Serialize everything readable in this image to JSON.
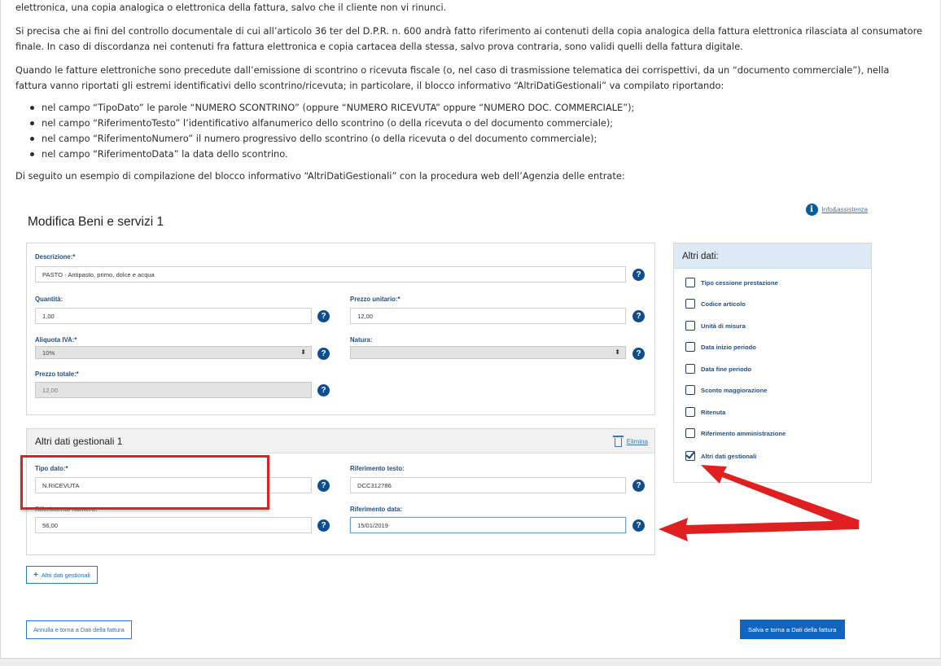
{
  "article": {
    "p0": "elettronica, una  copia analogica o elettronica della fattura, salvo che il cliente non vi rinunci.",
    "p1": "Si precisa che ai fini del controllo documentale di cui all’articolo 36 ter del D.P.R. n. 600 andrà fatto riferimento ai contenuti della copia analogica della fattura elettronica rilasciata al consumatore finale. In caso di discordanza nei contenuti fra fattura elettronica e copia cartacea della stessa, salvo prova contraria, sono validi quelli della fattura digitale.",
    "p2": "Quando le fatture elettroniche sono precedute dall’emissione di scontrino o ricevuta fiscale (o, nel caso di trasmissione telematica dei corrispettivi, da un “documento commerciale”), nella fattura vanno riportati gli estremi identificativi dello scontrino/ricevuta; in particolare, il blocco informativo “AltriDatiGestionali” va compilato riportando:",
    "bullets": [
      "nel campo “TipoDato” le parole “NUMERO SCONTRINO” (oppure “NUMERO RICEVUTA” oppure “NUMERO DOC. COMMERCIALE”);",
      "nel campo “RiferimentoTesto” l’identificativo alfanumerico dello scontrino (o della ricevuta o del documento commerciale);",
      "nel campo “RiferimentoNumero” il numero progressivo dello scontrino (o della ricevuta o del documento commerciale);",
      "nel campo “RiferimentoData” la data dello scontrino."
    ],
    "p3": "Di seguito un esempio di compilazione del blocco informativo “AltriDatiGestionali” con la procedura web dell’Agenzia delle entrate:"
  },
  "form": {
    "title": "Modifica Beni e servizi 1",
    "help_link": "Info&assistenza",
    "help_glyph": "i",
    "qmark": "?",
    "select_arrows": "⬍",
    "descrizione_label": "Descrizione:*",
    "descrizione_value": "PASTO - Antipasto, primo, dolce e acqua",
    "quantita_label": "Quantità:",
    "quantita_value": "1,00",
    "prezzo_unitario_label": "Prezzo unitario:*",
    "prezzo_unitario_value": "12,00",
    "aliquota_label": "Aliquota IVA:*",
    "aliquota_value": "10%",
    "natura_label": "Natura:",
    "natura_value": "",
    "prezzo_totale_label": "Prezzo totale:*",
    "prezzo_totale_value": "12,00"
  },
  "gestionali": {
    "title": "Altri dati gestionali 1",
    "elimina": "Elimina",
    "tipo_dato_label": "Tipo dato:*",
    "tipo_dato_value": "N.RICEVUTA",
    "rif_testo_label": "Riferimento testo:",
    "rif_testo_value": "DCC312786",
    "rif_numero_label": "Riferimento numero:",
    "rif_numero_value": "56,00",
    "rif_data_label": "Riferimento data:",
    "rif_data_value": "15/01/2019",
    "add_button": "Altri dati gestionali",
    "add_glyph": "+"
  },
  "sidebar": {
    "title": "Altri dati:",
    "items": [
      {
        "label": "Tipo cessione prestazione",
        "checked": false
      },
      {
        "label": "Codice articolo",
        "checked": false
      },
      {
        "label": "Unità di misura",
        "checked": false
      },
      {
        "label": "Data inizio periodo",
        "checked": false
      },
      {
        "label": "Data fine periodo",
        "checked": false
      },
      {
        "label": "Sconto maggiorazione",
        "checked": false
      },
      {
        "label": "Ritenuta",
        "checked": false
      },
      {
        "label": "Riferimento amministrazione",
        "checked": false
      },
      {
        "label": "Altri dati gestionali",
        "checked": true
      }
    ]
  },
  "buttons": {
    "cancel": "Annulla e torna a Dati della fattura",
    "save": "Salva e torna a Dati della fattura"
  },
  "colors": {
    "annotation_red": "#d62525",
    "accent_blue": "#0e66c2",
    "label_blue": "#1f4f82"
  }
}
